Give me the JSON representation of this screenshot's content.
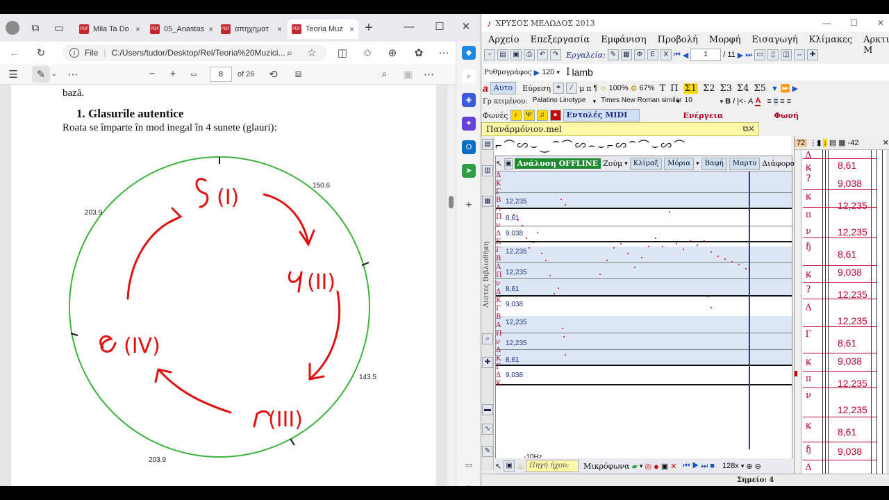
{
  "edge": {
    "tabs": [
      {
        "label": "Mila Ta Do",
        "active": false
      },
      {
        "label": "05_Anastas",
        "active": false
      },
      {
        "label": "απηχηματ",
        "active": false
      },
      {
        "label": "Teoria Muz",
        "active": true
      }
    ],
    "address": {
      "scheme": "File",
      "url": "C:/Users/tudor/Desktop/Rel/Teoria%20Muzici..."
    },
    "pdf_toolbar": {
      "page": "8",
      "of_pages": "of 26"
    },
    "pdf": {
      "cut_text": "bază.",
      "heading": "1. Glasurile autentice",
      "paragraph": "Roata se împarte în mod inegal în 4 sunete (glauri):",
      "wheel_labels": {
        "top_right": "150.6",
        "top_left": "203.9",
        "right": "143.5",
        "bottom": "203.9"
      },
      "handwriting": [
        "(I)",
        "(II)",
        "(III)",
        "(IV)"
      ]
    }
  },
  "melodos": {
    "title": "ΧΡΥΣΟΣ ΜΕΛΩΔΟΣ 2013",
    "menu": [
      "Αρχείο",
      "Επεξεργασία",
      "Εμφάνιση",
      "Προβολή",
      "Μορφή",
      "Εισαγωγή",
      "Κλίμακες",
      "Αρκτικές Μ"
    ],
    "toolbar1": {
      "tools_label": "Εργαλεία:",
      "page": "1",
      "pages": "/ 11"
    },
    "toolbar2": {
      "metronome_label": "Ρυθμογράφος",
      "tempo": "120",
      "mode_text": "lamb"
    },
    "toolbar3": {
      "auto": "Αυτο",
      "search": "Εύρεση",
      "zoom1": "100%",
      "zoom2": "67%",
      "sigmas": [
        "Σ1",
        "Σ2",
        "Σ3",
        "Σ4",
        "Σ5"
      ],
      "letters": [
        "Τ",
        "Π"
      ]
    },
    "toolbar4": {
      "font_label": "Γρ κειμένου:",
      "font1": "Palatino Linotype",
      "font2": "Times New Roman similar",
      "size": "10"
    },
    "toolbar5": {
      "voices": "Φωνές",
      "midi": "Εντολές MIDI",
      "energy": "Ενέργεια",
      "voice": "Φωνή"
    },
    "doc_title": "Πανάρμόνιον.mel",
    "analysis": {
      "offline": "Ανάλυση OFFLINE",
      "zoom": "Ζούμ",
      "buttons": [
        "Κλίμαξ",
        "Μόρια",
        "Βαφή",
        "Μαρτυ"
      ],
      "other": "Διάφορα",
      "side_tabs": "Λίστες Βιβλιοθήκη",
      "levels": [
        "12,235",
        "8,61",
        "9,038",
        "12,235",
        "12,235",
        "8,61",
        "9,038",
        "12,235",
        "12,235",
        "8,61",
        "9,038"
      ],
      "freq": "-10Hz",
      "source_label": "Πηγή ήχου:",
      "mic": "Μικρόφωνα",
      "zoom_level": "128x"
    },
    "scale": {
      "top_num": "72",
      "right_val": "-42",
      "values": [
        "8,61",
        "9,038",
        "12,235",
        "12,235",
        "8,61",
        "9,038",
        "12,235",
        "12,235",
        "8,61",
        "9,038",
        "12,235",
        "12,235",
        "8,61",
        "9,038"
      ]
    },
    "status": "Σημείο: 4"
  }
}
